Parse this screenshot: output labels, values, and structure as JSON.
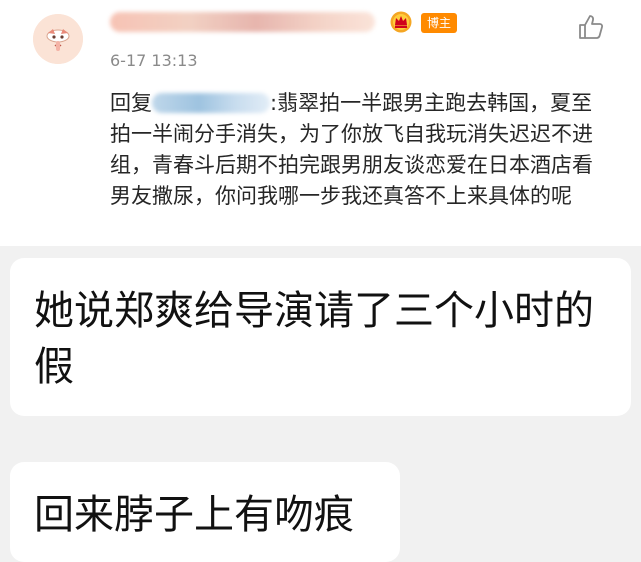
{
  "comment": {
    "avatar_icon": "cartoon-face-avatar",
    "role_badge": "博主",
    "timestamp": "6-17 13:13",
    "reply_prefix": "回复",
    "reply_text": ":翡翠拍一半跟男主跑去韩国，夏至拍一半闹分手消失，为了你放飞自我玩消失迟迟不进组，青春斗后期不拍完跟男朋友谈恋爱在日本酒店看男友撒尿，你问我哪一步我还真答不上来具体的呢",
    "like_icon": "thumbs-up-icon",
    "vip_icon": "crown-badge-icon"
  },
  "messages": [
    {
      "text": "她说郑爽给导演请了三个小时的假"
    },
    {
      "text": "回来脖子上有吻痕"
    }
  ],
  "colors": {
    "page_background": "#f1f1f1",
    "card_background": "#ffffff",
    "badge_orange": "#ff8a00",
    "timestamp_gray": "#8a8a8a"
  }
}
